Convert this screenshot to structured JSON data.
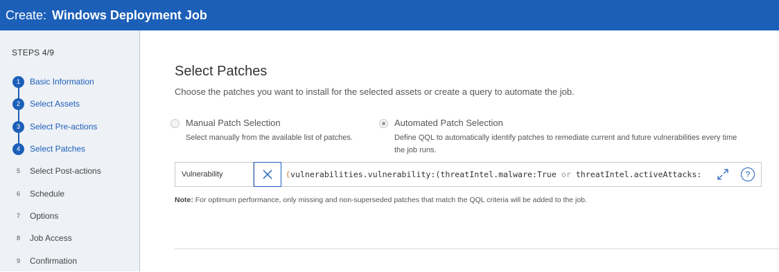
{
  "header": {
    "prefix": "Create:",
    "title": "Windows Deployment Job",
    "color": "#1c5fb8"
  },
  "sidebar": {
    "steps_count": "STEPS 4/9",
    "steps": [
      {
        "num": "1",
        "label": "Basic Information",
        "done": true
      },
      {
        "num": "2",
        "label": "Select Assets",
        "done": true
      },
      {
        "num": "3",
        "label": "Select Pre-actions",
        "done": true
      },
      {
        "num": "4",
        "label": "Select Patches",
        "done": true
      },
      {
        "num": "5",
        "label": "Select Post-actions",
        "done": false
      },
      {
        "num": "6",
        "label": "Schedule",
        "done": false
      },
      {
        "num": "7",
        "label": "Options",
        "done": false
      },
      {
        "num": "8",
        "label": "Job Access",
        "done": false
      },
      {
        "num": "9",
        "label": "Confirmation",
        "done": false
      }
    ]
  },
  "main": {
    "title": "Select Patches",
    "subtitle": "Choose the patches you want to install for the selected assets or create a query to automate the job.",
    "options": {
      "manual": {
        "label": "Manual Patch Selection",
        "desc": "Select manually from the available list of patches.",
        "checked": false
      },
      "automated": {
        "label": "Automated Patch Selection",
        "desc_line1": "Define QQL to automatically identify patches to remediate current and future vulnerabilities every time",
        "desc_line2": "the job runs.",
        "checked": true
      }
    },
    "query": {
      "field": "Vulnerability",
      "paren": "(",
      "text_part1": "vulnerabilities.vulnerability:(threatIntel.malware:True ",
      "keyword": "or",
      "text_part2": " threatIntel.activeAttacks:",
      "help_label": "?"
    },
    "note": {
      "label": "Note:",
      "text": " For optimum performance, only missing and non-superseded patches that match the QQL criteria will be added to the job."
    }
  },
  "icons": {
    "clear": "close-x-icon",
    "expand": "expand-icon",
    "help": "help-icon"
  }
}
